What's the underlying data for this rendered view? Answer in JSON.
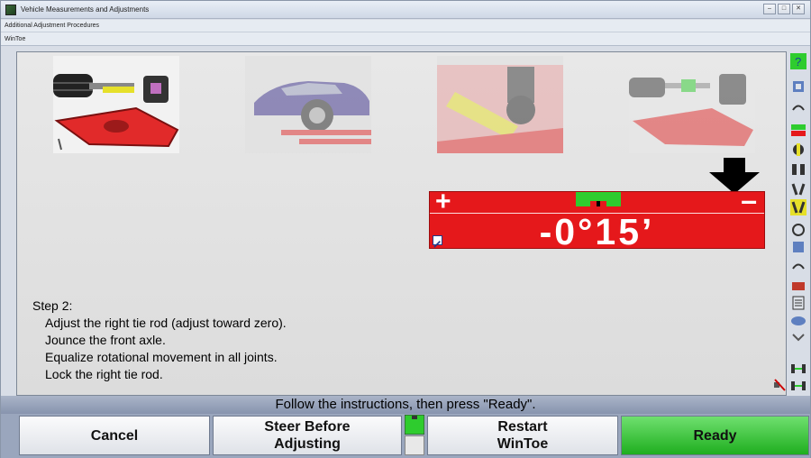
{
  "window": {
    "title": "Vehicle Measurements and Adjustments",
    "controls": [
      "–",
      "□",
      "✕"
    ]
  },
  "breadcrumbs": [
    "Additional Adjustment Procedures",
    "WinToe"
  ],
  "procedure_images": [
    {
      "name": "tie-rod-adjust",
      "state": "active"
    },
    {
      "name": "car-on-lift",
      "state": "inactive"
    },
    {
      "name": "ball-joint",
      "state": "inactive"
    },
    {
      "name": "tie-rod-lock",
      "state": "inactive"
    }
  ],
  "gauge": {
    "plus": "+",
    "minus": "–",
    "value": "-0°15’",
    "color": "#e5181b",
    "target_color": "#2ecc2e"
  },
  "step": {
    "title": "Step 2:",
    "lines": [
      "Adjust the right tie rod (adjust toward zero).",
      "Jounce the front axle.",
      "Equalize rotational movement in all joints.",
      "Lock the right tie rod."
    ]
  },
  "status": "Follow the instructions, then press \"Ready\".",
  "buttons": {
    "cancel": "Cancel",
    "steer_1": "Steer Before",
    "steer_2": "Adjusting",
    "restart_1": "Restart",
    "restart_2": "WinToe",
    "ready": "Ready"
  },
  "colors": {
    "accent_green": "#2ecc2e",
    "gauge_red": "#e5181b"
  }
}
